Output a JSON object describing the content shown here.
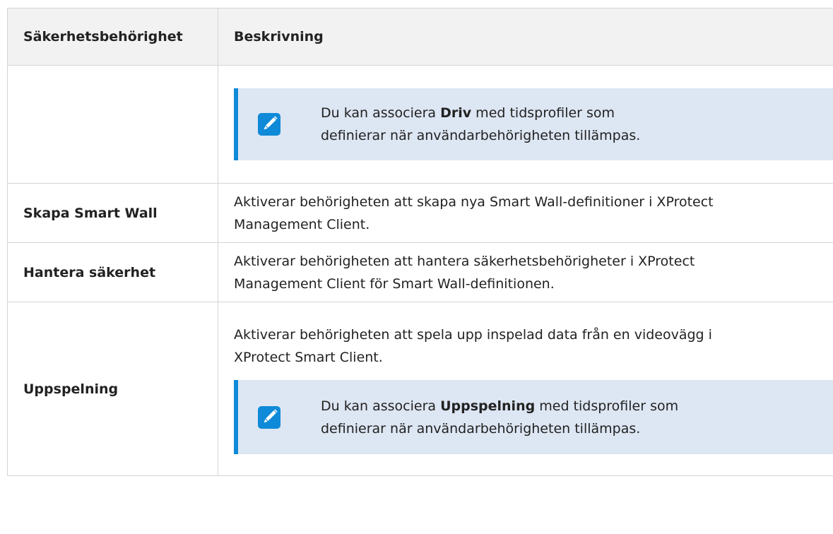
{
  "table": {
    "headers": {
      "permission": "Säkerhetsbehörighet",
      "description": "Beskrivning"
    },
    "note_row": {
      "note": {
        "icon": "pencil-note-icon",
        "prefix": "Du kan associera ",
        "bold": "Driv",
        "suffix": " med tidsprofiler som",
        "line2": "definierar när användarbehörigheten tillämpas."
      }
    },
    "rows": [
      {
        "name": "Skapa Smart Wall",
        "desc_line1": "Aktiverar behörigheten att skapa nya Smart Wall-definitioner i XProtect",
        "desc_line2": "Management Client."
      },
      {
        "name": "Hantera säkerhet",
        "desc_line1": "Aktiverar behörigheten att hantera säkerhetsbehörigheter i XProtect",
        "desc_line2": "Management Client för Smart Wall-definitionen."
      },
      {
        "name": "Uppspelning",
        "desc_line1": "Aktiverar behörigheten att spela upp inspelad data från en videovägg i",
        "desc_line2": "XProtect Smart Client.",
        "note": {
          "icon": "pencil-note-icon",
          "prefix": "Du kan associera ",
          "bold": "Uppspelning",
          "suffix": " med tidsprofiler som",
          "line2": "definierar när användarbehörigheten tillämpas."
        }
      }
    ]
  },
  "colors": {
    "note_background": "#dde6f3",
    "note_accent": "#0e8ad8",
    "header_background": "#f2f2f2",
    "border": "#d4d4d4"
  }
}
